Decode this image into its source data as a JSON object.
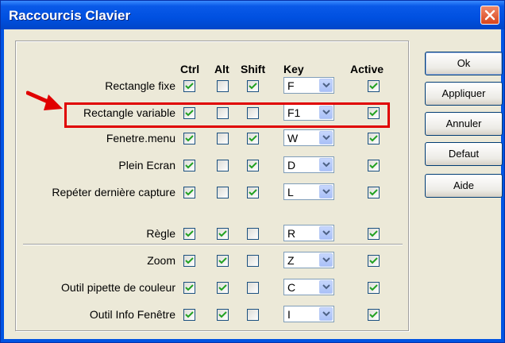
{
  "window": {
    "title": "Raccourcis Clavier"
  },
  "columns": {
    "ctrl": "Ctrl",
    "alt": "Alt",
    "shift": "Shift",
    "key": "Key",
    "active": "Active"
  },
  "rows": [
    {
      "label": "Rectangle fixe",
      "ctrl": true,
      "alt": false,
      "shift": true,
      "key": "F",
      "active": true
    },
    {
      "label": "Rectangle variable",
      "ctrl": true,
      "alt": false,
      "shift": false,
      "key": "F1",
      "active": true
    },
    {
      "label": "Fenetre.menu",
      "ctrl": true,
      "alt": false,
      "shift": true,
      "key": "W",
      "active": true
    },
    {
      "label": "Plein Ecran",
      "ctrl": true,
      "alt": false,
      "shift": true,
      "key": "D",
      "active": true
    },
    {
      "label": "Repéter dernière capture",
      "ctrl": true,
      "alt": false,
      "shift": true,
      "key": "L",
      "active": true
    },
    {
      "label": "Règle",
      "ctrl": true,
      "alt": true,
      "shift": false,
      "key": "R",
      "active": true
    },
    {
      "label": "Zoom",
      "ctrl": true,
      "alt": true,
      "shift": false,
      "key": "Z",
      "active": true
    },
    {
      "label": "Outil pipette de couleur",
      "ctrl": true,
      "alt": true,
      "shift": false,
      "key": "C",
      "active": true
    },
    {
      "label": "Outil Info Fenêtre",
      "ctrl": true,
      "alt": true,
      "shift": false,
      "key": "I",
      "active": true
    }
  ],
  "buttons": {
    "ok": "Ok",
    "apply": "Appliquer",
    "cancel": "Annuler",
    "default": "Defaut",
    "help": "Aide"
  },
  "annotation": {
    "highlight_color": "#e00000",
    "arrow_color": "#e00000"
  }
}
